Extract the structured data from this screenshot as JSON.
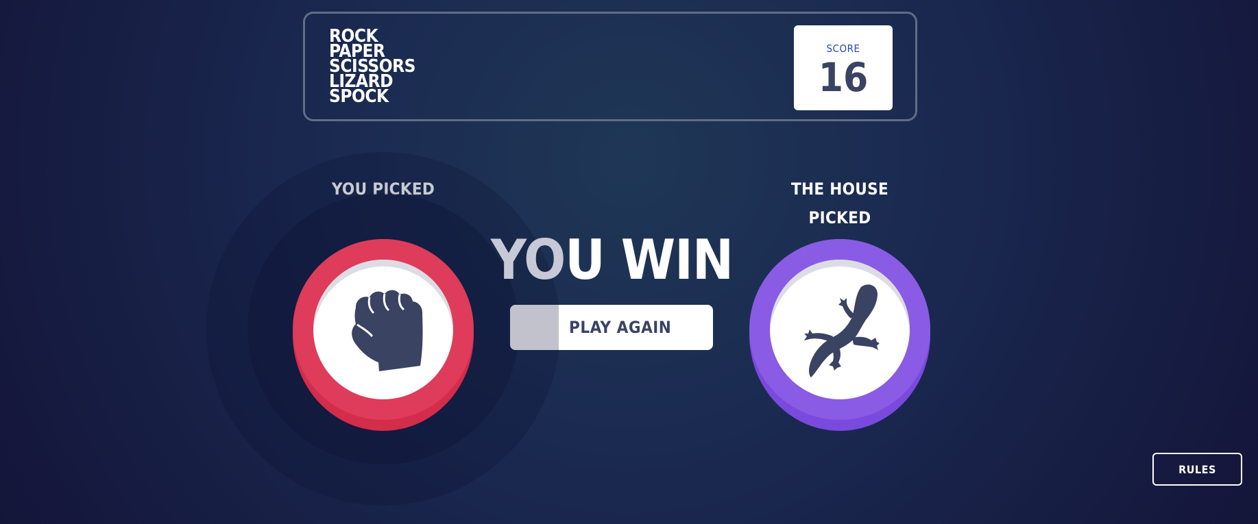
{
  "header": {
    "title_lines": [
      "ROCK",
      "PAPER",
      "SCISSORS",
      "LIZARD",
      "SPOCK"
    ],
    "score_label": "SCORE",
    "score_value": "16"
  },
  "game": {
    "player_label": "YOU PICKED",
    "house_label_line1": "THE HOUSE",
    "house_label_line2": "PICKED",
    "player_pick": "rock",
    "house_pick": "lizard",
    "result_text": "YOU WIN",
    "result_dim_part": "YO",
    "result_rest_part": "U WIN",
    "play_again_label": "PLAY AGAIN"
  },
  "footer": {
    "rules_label": "RULES"
  },
  "colors": {
    "rock": "#de3c5a",
    "lizard": "#8a5be5",
    "score_label": "#2a46c0",
    "dark_text": "#3b4363",
    "border": "#606e85"
  },
  "icons": {
    "player": "rock-fist-icon",
    "house": "lizard-icon"
  }
}
